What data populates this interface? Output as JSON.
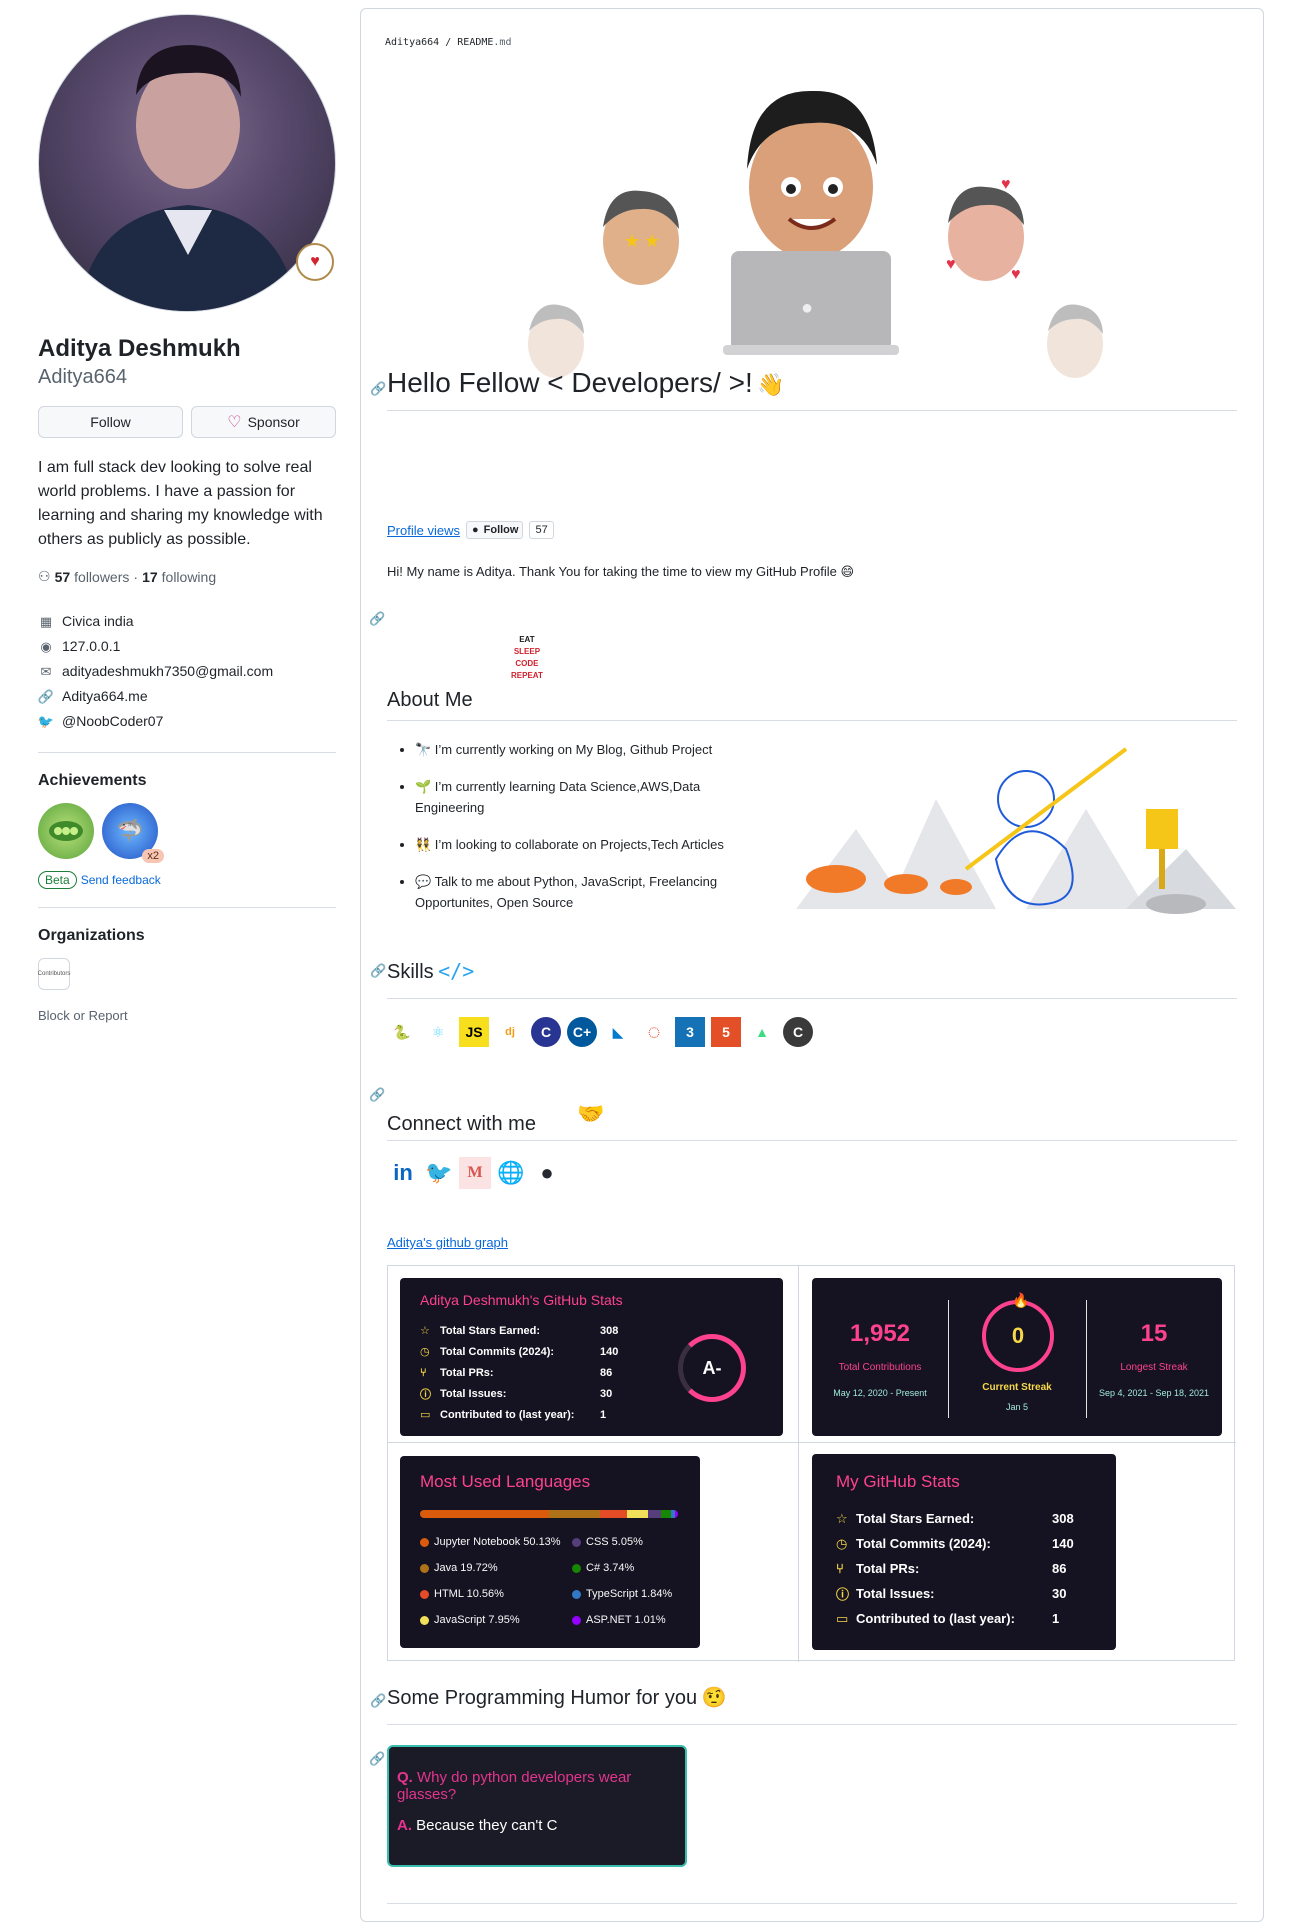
{
  "profile": {
    "fullname": "Aditya Deshmukh",
    "username": "Aditya664",
    "follow_label": "Follow",
    "sponsor_label": "Sponsor",
    "bio": "I am full stack dev looking to solve real world problems. I have a passion for learning and sharing my knowledge with others as publicly as possible.",
    "followers_count": "57",
    "followers_label": "followers",
    "following_count": "17",
    "following_label": "following",
    "company": "Civica india",
    "location": "127.0.0.1",
    "email": "adityadeshmukh7350@gmail.com",
    "website": "Aditya664.me",
    "twitter": "@NoobCoder07",
    "achievements_heading": "Achievements",
    "achievement_multiplier": "x2",
    "beta_label": "Beta",
    "feedback_label": "Send feedback",
    "organizations_heading": "Organizations",
    "org_logo_text": "Contributors",
    "block_report": "Block or Report"
  },
  "readme": {
    "path_user": "Aditya664",
    "path_sep": "/",
    "path_file": "README",
    "path_ext": ".md",
    "hello_heading": "Hello Fellow < Developers/ >!",
    "hello_emoji": "👋",
    "profile_views_link": "Profile views",
    "follow_badge_label": "Follow",
    "follow_badge_count": "57",
    "greeting": "Hi! My name is Aditya. Thank You for taking the time to view my GitHub Profile 😄",
    "eat_sleep": [
      "EAT",
      "SLEEP",
      "CODE",
      "REPEAT"
    ],
    "about_heading": "About Me",
    "about_items": [
      "🔭 I’m currently working on My Blog, Github Project",
      "🌱 I’m currently learning Data Science,AWS,Data Engineering",
      "👯 I’m looking to collaborate on Projects,Tech Articles",
      "💬 Talk to me about Python, JavaScript, Freelancing Opportunites, Open Source"
    ],
    "skills_heading": "Skills",
    "skills_icon": "</>",
    "skills": [
      {
        "name": "python-icon",
        "glyph": "🐍"
      },
      {
        "name": "react-icon",
        "glyph": "⚛"
      },
      {
        "name": "javascript-icon",
        "glyph": "JS"
      },
      {
        "name": "django-icon",
        "glyph": "dj"
      },
      {
        "name": "c-icon",
        "glyph": "C"
      },
      {
        "name": "cplusplus-icon",
        "glyph": "C+"
      },
      {
        "name": "vscode-icon",
        "glyph": "◣"
      },
      {
        "name": "pytorch-icon",
        "glyph": "◌"
      },
      {
        "name": "css3-icon",
        "glyph": "3"
      },
      {
        "name": "html5-icon",
        "glyph": "5"
      },
      {
        "name": "android-icon",
        "glyph": "▲"
      },
      {
        "name": "csharp-icon",
        "glyph": "C"
      }
    ],
    "connect_heading": "Connect with me",
    "socials": [
      {
        "name": "linkedin-icon",
        "glyph": "in"
      },
      {
        "name": "twitter-icon",
        "glyph": "🐦"
      },
      {
        "name": "medium-icon",
        "glyph": "M"
      },
      {
        "name": "website-icon",
        "glyph": "🌐"
      },
      {
        "name": "github-icon",
        "glyph": "●"
      }
    ],
    "graph_link": "Aditya's github graph",
    "stats_card": {
      "title": "Aditya Deshmukh's GitHub Stats",
      "rows": [
        {
          "label": "Total Stars Earned:",
          "value": "308",
          "icon": "star-icon"
        },
        {
          "label": "Total Commits (2024):",
          "value": "140",
          "icon": "clock-icon"
        },
        {
          "label": "Total PRs:",
          "value": "86",
          "icon": "pr-icon"
        },
        {
          "label": "Total Issues:",
          "value": "30",
          "icon": "issue-icon"
        },
        {
          "label": "Contributed to (last year):",
          "value": "1",
          "icon": "repo-icon"
        }
      ],
      "grade": "A-"
    },
    "streak_card": {
      "total": "1,952",
      "total_label": "Total Contributions",
      "total_range": "May 12, 2020 - Present",
      "current": "0",
      "current_label": "Current Streak",
      "current_date": "Jan 5",
      "longest": "15",
      "longest_label": "Longest Streak",
      "longest_range": "Sep 4, 2021 - Sep 18, 2021"
    },
    "languages_card": {
      "title": "Most Used Languages",
      "bar": [
        {
          "color": "#DA5B0B",
          "pct": 50.13
        },
        {
          "color": "#b07219",
          "pct": 19.72
        },
        {
          "color": "#e34c26",
          "pct": 10.56
        },
        {
          "color": "#f1e05a",
          "pct": 7.95
        },
        {
          "color": "#563d7c",
          "pct": 5.05
        },
        {
          "color": "#178600",
          "pct": 3.74
        },
        {
          "color": "#3178c6",
          "pct": 1.84
        },
        {
          "color": "#9400ff",
          "pct": 1.01
        }
      ],
      "items": [
        {
          "label": "Jupyter Notebook 50.13%",
          "color": "#DA5B0B"
        },
        {
          "label": "CSS 5.05%",
          "color": "#563d7c"
        },
        {
          "label": "Java 19.72%",
          "color": "#b07219"
        },
        {
          "label": "C# 3.74%",
          "color": "#178600"
        },
        {
          "label": "HTML 10.56%",
          "color": "#e34c26"
        },
        {
          "label": "TypeScript 1.84%",
          "color": "#3178c6"
        },
        {
          "label": "JavaScript 7.95%",
          "color": "#f1e05a"
        },
        {
          "label": "ASP.NET 1.01%",
          "color": "#9400ff"
        }
      ]
    },
    "my_stats_card": {
      "title": "My GitHub Stats",
      "rows": [
        {
          "label": "Total Stars Earned:",
          "value": "308"
        },
        {
          "label": "Total Commits (2024):",
          "value": "140"
        },
        {
          "label": "Total PRs:",
          "value": "86"
        },
        {
          "label": "Total Issues:",
          "value": "30"
        },
        {
          "label": "Contributed to (last year):",
          "value": "1"
        }
      ]
    },
    "humor_heading": "Some Programming Humor for you",
    "humor_emoji": "🤨",
    "joke": {
      "q_prefix": "Q.",
      "question": "Why do python developers wear glasses?",
      "a_prefix": "A.",
      "answer": "Because they can't C"
    }
  }
}
